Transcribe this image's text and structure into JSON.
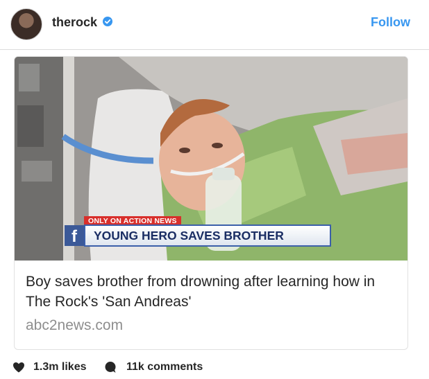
{
  "post": {
    "username": "therock",
    "follow_label": "Follow"
  },
  "link_card": {
    "chyron_tag": "ONLY ON ACTION NEWS",
    "chyron_headline": "YOUNG HERO SAVES BROTHER",
    "fb_badge": "f",
    "title": "Boy saves brother from drowning after learning how in The Rock's 'San Andreas'",
    "domain": "abc2news.com"
  },
  "engagement": {
    "likes": "1.3m likes",
    "comments": "11k comments"
  },
  "colors": {
    "accent": "#3897f0",
    "text": "#262626",
    "muted": "#8e8e8e"
  }
}
